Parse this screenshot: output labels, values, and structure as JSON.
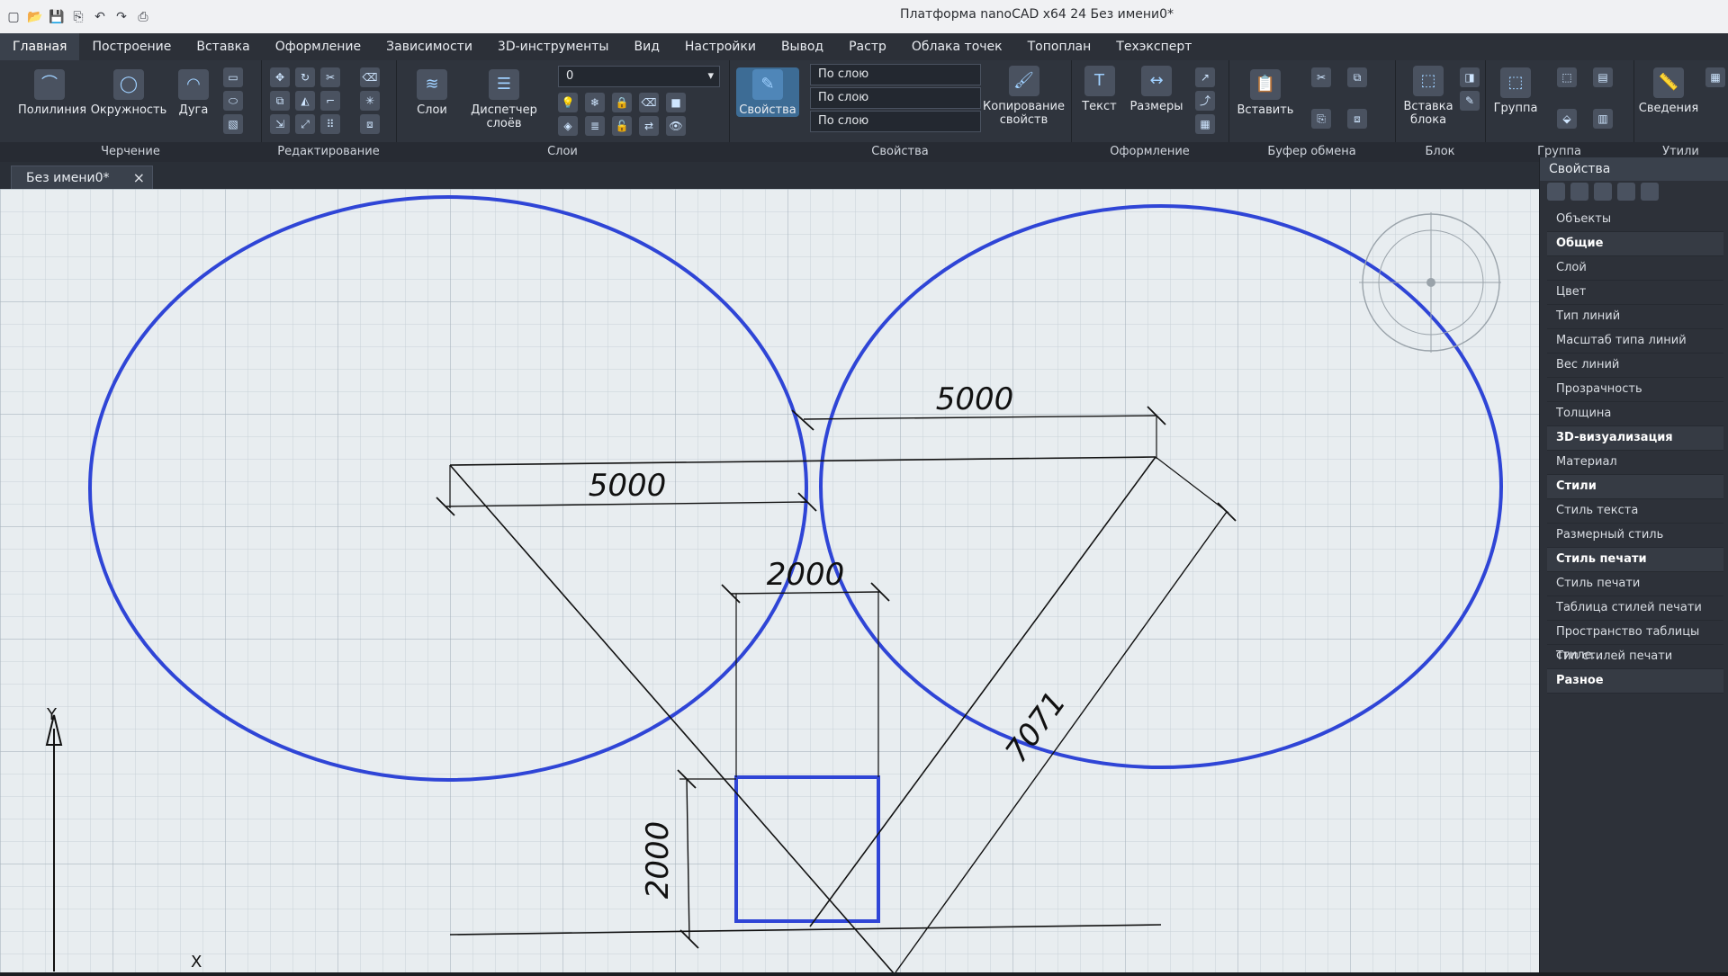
{
  "window": {
    "title": "Платформа nanoCAD x64 24 Без имени0*"
  },
  "menu": {
    "tabs": [
      {
        "label": "Главная"
      },
      {
        "label": "Построение"
      },
      {
        "label": "Вставка"
      },
      {
        "label": "Оформление"
      },
      {
        "label": "Зависимости"
      },
      {
        "label": "3D-инструменты"
      },
      {
        "label": "Вид"
      },
      {
        "label": "Настройки"
      },
      {
        "label": "Вывод"
      },
      {
        "label": "Растр"
      },
      {
        "label": "Облака точек"
      },
      {
        "label": "Топоплан"
      },
      {
        "label": "Техэксперт"
      }
    ]
  },
  "ribbon": {
    "draw": {
      "title": "Черчение",
      "polyline": "Полилиния",
      "circle": "Окружность",
      "arc": "Дуга"
    },
    "edit_title": "Редактирование",
    "layers": {
      "title": "Слои",
      "layers": "Слои",
      "layer_manager": "Диспетчер слоёв",
      "current_layer": "0"
    },
    "properties": {
      "title": "Свойства",
      "button": "Свойства",
      "by_layer": "По слою",
      "line_by_layer": "По слою",
      "weight_by_layer": "По слою",
      "copy_props": "Копирование свойств"
    },
    "decor": {
      "title": "Оформление",
      "text": "Текст",
      "dims": "Размеры"
    },
    "clipboard": {
      "title": "Буфер обмена",
      "paste": "Вставить"
    },
    "block": {
      "title": "Блок",
      "insert": "Вставка блока"
    },
    "group": {
      "title": "Группа",
      "group": "Группа"
    },
    "utils": {
      "title": "Утили",
      "info": "Сведения"
    }
  },
  "document": {
    "tab": "Без имени0*"
  },
  "drawing": {
    "dims": [
      "5000",
      "5000",
      "2000",
      "2000",
      "7071"
    ],
    "axis_y": "Y",
    "axis_x": "X",
    "colors": {
      "stroke": "#2f45d6",
      "line": "#111111",
      "bg": "#e8edf0",
      "grid": "#b3bec6"
    }
  },
  "properties_panel": {
    "title": "Свойства",
    "items": [
      {
        "label": "Объекты"
      },
      {
        "label": "Общие"
      },
      {
        "label": "Слой"
      },
      {
        "label": "Цвет"
      },
      {
        "label": "Тип линий"
      },
      {
        "label": "Масштаб типа линий"
      },
      {
        "label": "Вес линий"
      },
      {
        "label": "Прозрачность"
      },
      {
        "label": "Толщина"
      },
      {
        "label": "3D-визуализация"
      },
      {
        "label": "Материал"
      },
      {
        "label": "Стили"
      },
      {
        "label": "Стиль текста"
      },
      {
        "label": "Размерный стиль"
      },
      {
        "label": "Стиль печати"
      },
      {
        "label": "Стиль печати"
      },
      {
        "label": "Таблица стилей печати"
      },
      {
        "label": "Пространство таблицы стиле..."
      },
      {
        "label": "Тип стилей печати"
      },
      {
        "label": "Разное"
      }
    ]
  }
}
